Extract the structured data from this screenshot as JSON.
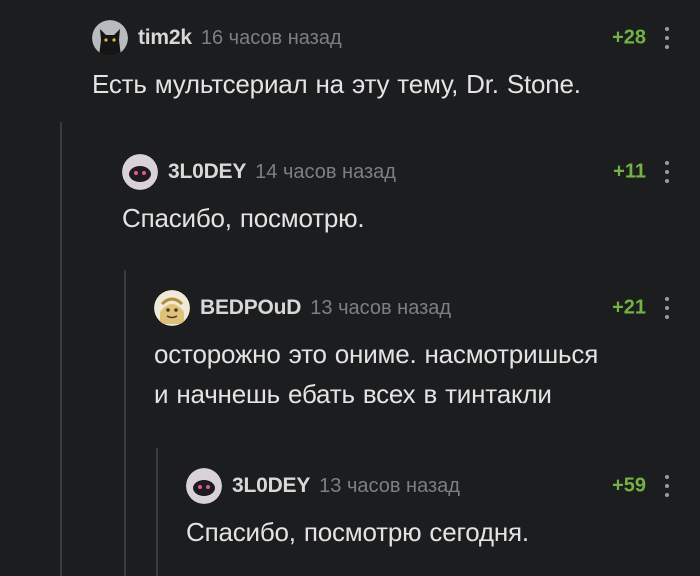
{
  "comments": [
    {
      "username": "tim2k",
      "timestamp": "16 часов назад",
      "rating": "+28",
      "avatar": "black-cat-avatar",
      "text": "Есть мультсериал на эту тему, Dr. Stone."
    },
    {
      "username": "3L0DEY",
      "timestamp": "14 часов назад",
      "rating": "+11",
      "avatar": "dark-creature-avatar",
      "text": "Спасибо, посмотрю."
    },
    {
      "username": "BEDPOuD",
      "timestamp": "13 часов назад",
      "rating": "+21",
      "avatar": "cartoon-face-avatar",
      "text_lines": [
        "осторожно это ониме. насмотришься",
        "и начнешь ебать всех в тинтакли"
      ]
    },
    {
      "username": "3L0DEY",
      "timestamp": "13 часов назад",
      "rating": "+59",
      "avatar": "dark-creature-avatar",
      "text": "Спасибо, посмотрю сегодня."
    }
  ],
  "colors": {
    "background": "#1c1d1f",
    "rating_positive": "#74b244",
    "username": "#d8d8d8",
    "timestamp": "#7e7f82",
    "text": "#e3e3e3",
    "thread_line": "#3a3b3e"
  }
}
